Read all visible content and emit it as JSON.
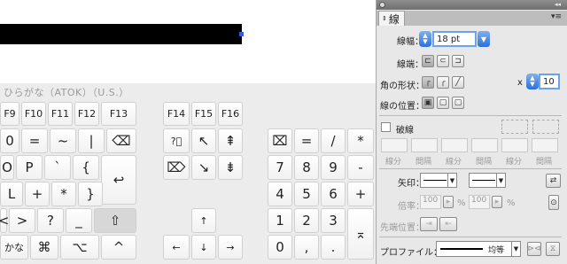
{
  "keyboard": {
    "title": "ひらがな（ATOK）（U.S.）",
    "fn_row": [
      "F9",
      "F10",
      "F11",
      "F12",
      "F13",
      "F14",
      "F15",
      "F16"
    ],
    "row1": [
      "0",
      "=",
      "~",
      "|",
      "⌫",
      "?⃝",
      "↖",
      "⇞",
      "⌧",
      "=",
      "/",
      "*"
    ],
    "row2": [
      "O",
      "P",
      "`",
      "{",
      "↩",
      "⌦",
      "↘",
      "⇟",
      "7",
      "8",
      "9",
      "-"
    ],
    "row3": [
      "L",
      "+",
      "*",
      "}",
      "4",
      "5",
      "6",
      "+"
    ],
    "row4": [
      "<",
      ">",
      "?",
      "_",
      "⇧",
      "↑",
      "1",
      "2",
      "3"
    ],
    "row5": [
      "かな",
      "⌘",
      "⌥",
      "^",
      "←",
      "↓",
      "→",
      "0",
      ",",
      "."
    ],
    "enter_glyph": "⌅"
  },
  "panel": {
    "tab_label": "線",
    "weight_label": "線幅：",
    "weight_value": "18 pt",
    "cap_label": "線端：",
    "corner_label": "角の形状：",
    "limit_prefix": "x",
    "limit_value": "10",
    "align_label": "線の位置：",
    "dashed_label": "破線",
    "dash_labels": [
      "線分",
      "間隔",
      "線分",
      "間隔",
      "線分",
      "間隔"
    ],
    "arrow_label": "矢印：",
    "scale_label": "倍率：",
    "scale_value_1": "100",
    "scale_value_2": "100",
    "percent": "%",
    "arrow_align_label": "先端位置：",
    "profile_label": "プロファイル：",
    "profile_value": "均等"
  },
  "colors": {
    "accent": "#2d6fd6",
    "stroke": "#000000",
    "panel_bg": "#e8e8e8"
  }
}
